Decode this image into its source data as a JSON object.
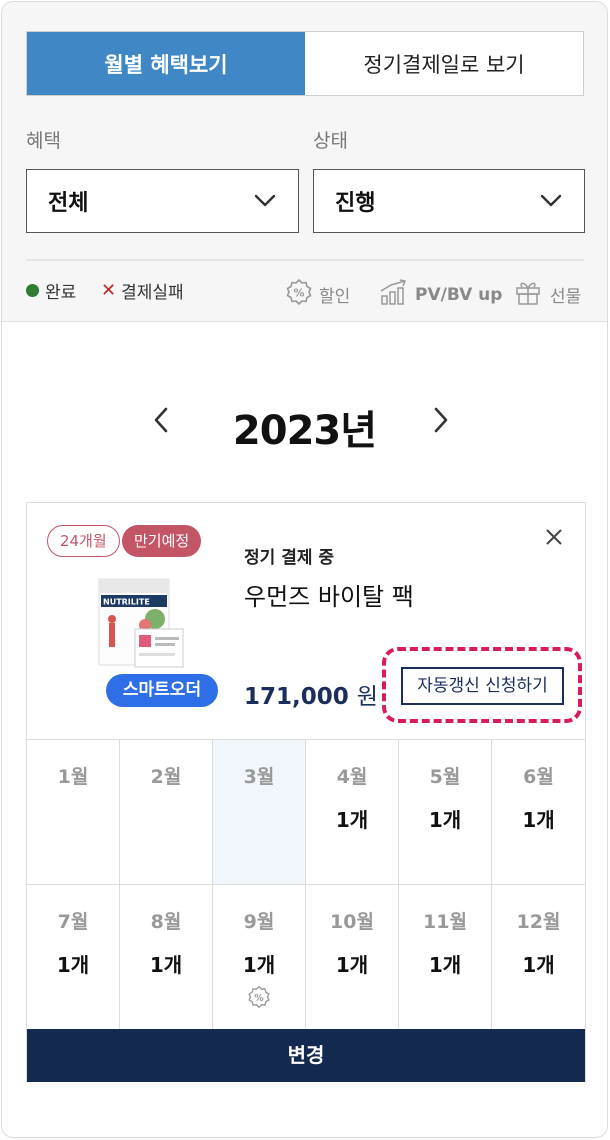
{
  "tabs": [
    {
      "label": "월별 혜택보기",
      "active": true
    },
    {
      "label": "정기결제일로 보기",
      "active": false
    }
  ],
  "filters": {
    "benefit": {
      "label": "혜택",
      "value": "전체"
    },
    "status": {
      "label": "상태",
      "value": "진행"
    }
  },
  "legend": {
    "done": "완료",
    "failed": "결제실패",
    "discount": "할인",
    "pvbv": "PV/BV up",
    "gift": "선물"
  },
  "year": {
    "label": "2023년"
  },
  "card": {
    "period_tag": "24개월",
    "expiry_tag": "만기예정",
    "status": "정기 결제 중",
    "product_name": "우먼즈 바이탈 팩",
    "badge": "스마트오더",
    "price": "171,000",
    "price_unit": "원",
    "renew_button": "자동갱신 신청하기",
    "product_brand": "NUTRILITE",
    "months": [
      {
        "label": "1월",
        "count": ""
      },
      {
        "label": "2월",
        "count": ""
      },
      {
        "label": "3월",
        "count": "",
        "current": true
      },
      {
        "label": "4월",
        "count": "1개"
      },
      {
        "label": "5월",
        "count": "1개"
      },
      {
        "label": "6월",
        "count": "1개"
      },
      {
        "label": "7월",
        "count": "1개"
      },
      {
        "label": "8월",
        "count": "1개"
      },
      {
        "label": "9월",
        "count": "1개",
        "discount": true
      },
      {
        "label": "10월",
        "count": "1개"
      },
      {
        "label": "11월",
        "count": "1개"
      },
      {
        "label": "12월",
        "count": "1개"
      }
    ],
    "change_button": "변경"
  },
  "colors": {
    "tab_active": "#3f88c5",
    "accent_tag": "#c45566",
    "badge_blue": "#2e6ee6",
    "navy": "#13294f",
    "highlight": "#d81b5a",
    "done_dot": "#2e7d32",
    "fail_x": "#c62828"
  },
  "icons": [
    "chevron-down-icon",
    "discount-badge-icon",
    "bar-chart-up-icon",
    "gift-icon",
    "chevron-left-icon",
    "chevron-right-icon",
    "close-icon"
  ]
}
